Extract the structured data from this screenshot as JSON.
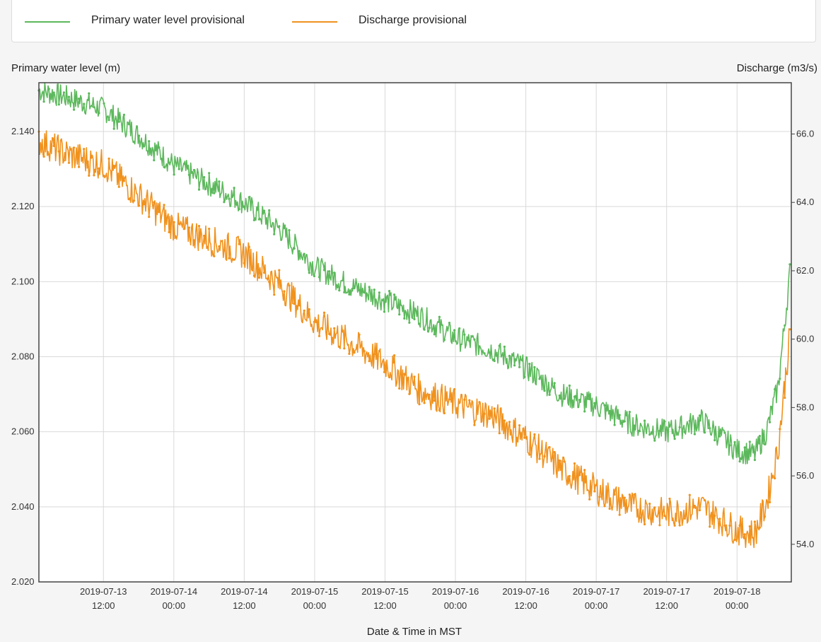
{
  "legend": {
    "items": [
      {
        "label": "Primary water level provisional",
        "color": "#5cb85c"
      },
      {
        "label": "Discharge provisional",
        "color": "#f0921e"
      }
    ]
  },
  "chart_data": {
    "type": "line",
    "xlabel": "Date & Time in MST",
    "ylabel_left": "Primary water level (m)",
    "ylabel_right": "Discharge (m3/s)",
    "grid": true,
    "legend_placement": "top",
    "x_range": [
      "2019-07-13 01:00",
      "2019-07-18 09:15"
    ],
    "x_tick_labels": [
      [
        "2019-07-13",
        "12:00"
      ],
      [
        "2019-07-14",
        "00:00"
      ],
      [
        "2019-07-14",
        "12:00"
      ],
      [
        "2019-07-15",
        "00:00"
      ],
      [
        "2019-07-15",
        "12:00"
      ],
      [
        "2019-07-16",
        "00:00"
      ],
      [
        "2019-07-16",
        "12:00"
      ],
      [
        "2019-07-17",
        "00:00"
      ],
      [
        "2019-07-17",
        "12:00"
      ],
      [
        "2019-07-18",
        "00:00"
      ]
    ],
    "y_left": {
      "ticks": [
        "2.020",
        "2.040",
        "2.060",
        "2.080",
        "2.100",
        "2.120",
        "2.140"
      ],
      "range": [
        2.02,
        2.153
      ]
    },
    "y_right": {
      "ticks": [
        "54.0",
        "56.0",
        "58.0",
        "60.0",
        "62.0",
        "64.0",
        "66.0"
      ],
      "range": [
        52.9,
        67.5
      ]
    },
    "series": [
      {
        "name": "Primary water level provisional",
        "axis": "left",
        "color": "#5cb85c",
        "x": [
          "2019-07-13 01:00",
          "2019-07-13 06:00",
          "2019-07-13 12:00",
          "2019-07-13 18:00",
          "2019-07-14 00:00",
          "2019-07-14 06:00",
          "2019-07-14 12:00",
          "2019-07-14 18:00",
          "2019-07-15 00:00",
          "2019-07-15 06:00",
          "2019-07-15 12:00",
          "2019-07-15 18:00",
          "2019-07-16 00:00",
          "2019-07-16 06:00",
          "2019-07-16 12:00",
          "2019-07-16 18:00",
          "2019-07-17 00:00",
          "2019-07-17 06:00",
          "2019-07-17 12:00",
          "2019-07-17 18:00",
          "2019-07-18 00:00",
          "2019-07-18 03:00",
          "2019-07-18 05:00",
          "2019-07-18 07:00",
          "2019-07-18 09:00"
        ],
        "y": [
          2.151,
          2.149,
          2.146,
          2.139,
          2.131,
          2.126,
          2.121,
          2.114,
          2.104,
          2.099,
          2.095,
          2.091,
          2.085,
          2.082,
          2.077,
          2.07,
          2.067,
          2.062,
          2.06,
          2.063,
          2.055,
          2.054,
          2.06,
          2.072,
          2.102
        ]
      },
      {
        "name": "Discharge provisional",
        "axis": "right",
        "color": "#f0921e",
        "x": [
          "2019-07-13 01:00",
          "2019-07-13 06:00",
          "2019-07-13 12:00",
          "2019-07-13 18:00",
          "2019-07-14 00:00",
          "2019-07-14 06:00",
          "2019-07-14 12:00",
          "2019-07-14 18:00",
          "2019-07-15 00:00",
          "2019-07-15 06:00",
          "2019-07-15 12:00",
          "2019-07-15 18:00",
          "2019-07-16 00:00",
          "2019-07-16 06:00",
          "2019-07-16 12:00",
          "2019-07-16 18:00",
          "2019-07-17 00:00",
          "2019-07-17 06:00",
          "2019-07-17 12:00",
          "2019-07-17 18:00",
          "2019-07-18 00:00",
          "2019-07-18 03:00",
          "2019-07-18 05:00",
          "2019-07-18 07:00",
          "2019-07-18 09:00"
        ],
        "y": [
          65.8,
          65.4,
          65.1,
          64.2,
          63.3,
          62.9,
          62.5,
          61.6,
          60.5,
          59.9,
          59.3,
          58.5,
          58.1,
          57.8,
          57.1,
          56.2,
          55.6,
          55.1,
          54.9,
          55.1,
          54.4,
          54.3,
          55.2,
          56.8,
          60.1
        ]
      }
    ]
  }
}
